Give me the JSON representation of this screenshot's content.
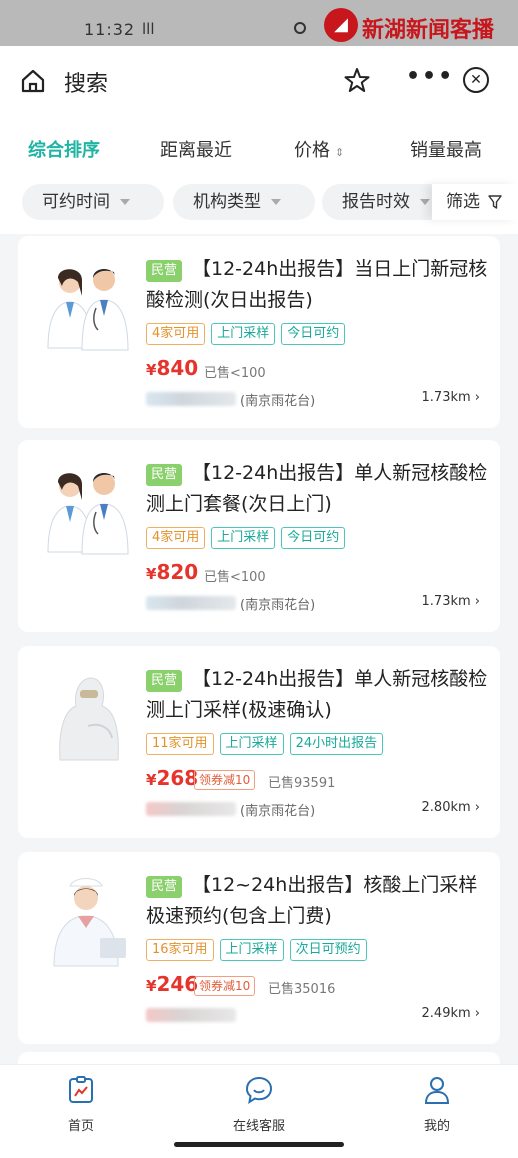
{
  "status_bar": {
    "time": "11:32",
    "signal": "lll",
    "watermark": "新湖新闻客播"
  },
  "header": {
    "title": "搜索",
    "icons": [
      "home-icon",
      "star-icon",
      "more-icon",
      "close-icon"
    ]
  },
  "sort_tabs": [
    {
      "label": "综合排序",
      "active": true
    },
    {
      "label": "距离最近",
      "active": false
    },
    {
      "label": "价格",
      "active": false,
      "sort_icon": "⇕"
    },
    {
      "label": "销量最高",
      "active": false
    }
  ],
  "filters": [
    "可约时间",
    "机构类型",
    "报告时效"
  ],
  "screen_label": "筛选",
  "products": [
    {
      "org_tag": "民营",
      "title": "【12-24h出报告】当日上门新冠核酸检测(次日出报告)",
      "badges": [
        {
          "text": "4家可用",
          "style": "o"
        },
        {
          "text": "上门采样",
          "style": "g"
        },
        {
          "text": "今日可约",
          "style": "g"
        }
      ],
      "price": "840",
      "currency": "¥",
      "coupon": "",
      "sold": "已售<100",
      "location": "(南京雨花台)",
      "distance": "1.73km ›"
    },
    {
      "org_tag": "民营",
      "title": "【12-24h出报告】单人新冠核酸检测上门套餐(次日上门)",
      "badges": [
        {
          "text": "4家可用",
          "style": "o"
        },
        {
          "text": "上门采样",
          "style": "g"
        },
        {
          "text": "今日可约",
          "style": "g"
        }
      ],
      "price": "820",
      "currency": "¥",
      "coupon": "",
      "sold": "已售<100",
      "location": "(南京雨花台)",
      "distance": "1.73km ›"
    },
    {
      "org_tag": "民营",
      "title": "【12-24h出报告】单人新冠核酸检测上门采样(极速确认)",
      "badges": [
        {
          "text": "11家可用",
          "style": "o"
        },
        {
          "text": "上门采样",
          "style": "g"
        },
        {
          "text": "24小时出报告",
          "style": "g"
        }
      ],
      "price": "268",
      "currency": "¥",
      "coupon": "领券减10",
      "sold": "已售93591",
      "location": "(南京雨花台)",
      "distance": "2.80km ›"
    },
    {
      "org_tag": "民营",
      "title": "【12~24h出报告】核酸上门采样极速预约(包含上门费)",
      "badges": [
        {
          "text": "16家可用",
          "style": "o"
        },
        {
          "text": "上门采样",
          "style": "g"
        },
        {
          "text": "次日可预约",
          "style": "g"
        }
      ],
      "price": "246",
      "currency": "¥",
      "coupon": "领券减10",
      "sold": "已售35016",
      "location": "",
      "distance": "2.49km ›"
    }
  ],
  "bottom_nav": [
    {
      "label": "首页",
      "icon": "home-page-icon"
    },
    {
      "label": "在线客服",
      "icon": "chat-icon"
    },
    {
      "label": "我的",
      "icon": "profile-icon"
    }
  ],
  "colors": {
    "accent": "#1fb4a4",
    "price": "#e5342b",
    "org_tag": "#8ad06c",
    "badge_orange": "#e3922a"
  }
}
